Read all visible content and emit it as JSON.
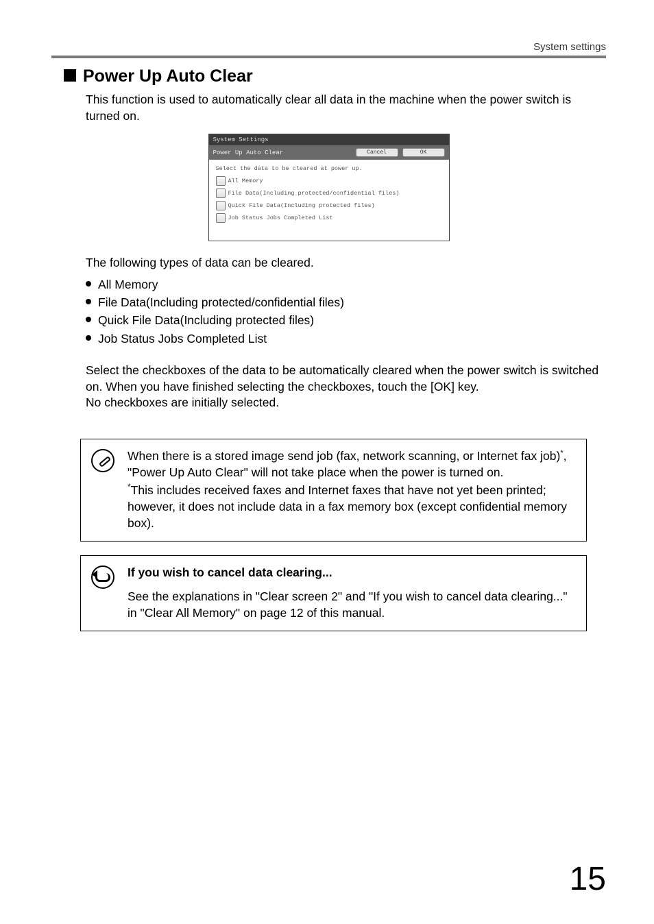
{
  "header": {
    "breadcrumb": "System settings"
  },
  "section": {
    "title": "Power Up Auto Clear",
    "intro": "This function is used to automatically clear all data in the machine when the power switch is turned on."
  },
  "dialog": {
    "system_label": "System Settings",
    "title": "Power Up Auto Clear",
    "cancel": "Cancel",
    "ok": "OK",
    "subtitle": "Select the data to be cleared at power up.",
    "items": [
      "All Memory",
      "File Data(Including protected/confidential files)",
      "Quick File Data(Including protected files)",
      "Job Status Jobs Completed List"
    ]
  },
  "followup": {
    "lead": "The following types of data can be cleared.",
    "bullets": [
      "All Memory",
      "File Data(Including protected/confidential files)",
      "Quick File Data(Including protected files)",
      "Job Status Jobs Completed List"
    ],
    "para1": "Select the checkboxes of the data to be automatically cleared when the power switch is switched on. When you have finished selecting the checkboxes, touch the [OK] key.",
    "para2": "No checkboxes are initially selected."
  },
  "note1": {
    "line1a": "When there is a stored image send job (fax, network scanning, or Internet fax job)",
    "line1b": ", \"Power Up Auto Clear\" will not take place when the power is turned on.",
    "foot": "This includes received faxes and Internet faxes that have not yet been printed; however, it does not include data in a fax memory box (except confidential memory box)."
  },
  "note2": {
    "heading": "If you wish to cancel data clearing...",
    "body": "See the explanations in \"Clear screen 2\" and \"If you wish to cancel data clearing...\" in \"Clear All Memory\" on page 12 of this manual."
  },
  "page_number": "15"
}
